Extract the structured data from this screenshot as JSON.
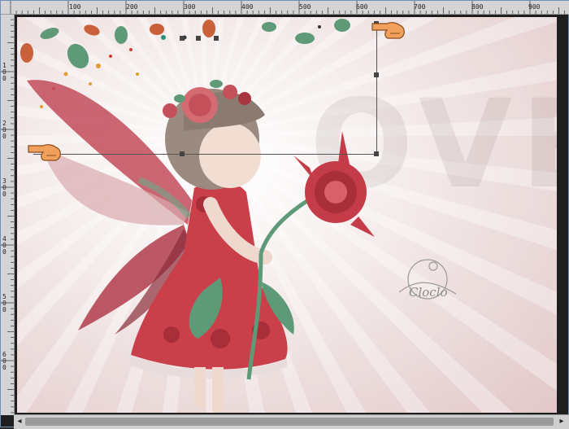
{
  "ruler": {
    "h_labels": [
      "100",
      "200",
      "300",
      "400",
      "500",
      "600",
      "700",
      "800",
      "900"
    ],
    "v_labels": [
      "1\n0\n0",
      "2\n0\n0",
      "3\n0\n0",
      "4\n0\n0",
      "5\n0\n0",
      "6\n0\n0"
    ]
  },
  "canvas": {
    "watermark_large": "OVE",
    "signature": "Cloclo",
    "colors": {
      "background": "#f1e6e5",
      "dress": "#c9404a",
      "wing": "#c24b5a",
      "leaf": "#5f9a78",
      "hair": "#9a8a7f"
    }
  },
  "tools": {
    "top_hand_icon": "pointing-hand-icon",
    "left_hand_icon": "pointing-hand-icon"
  },
  "scrollbar": {
    "left_arrow": "◂",
    "right_arrow": "▸"
  }
}
